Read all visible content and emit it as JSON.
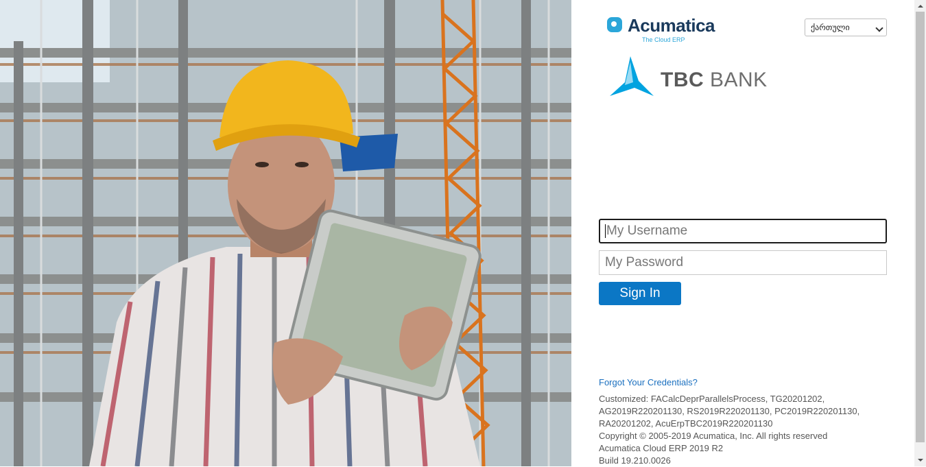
{
  "branding": {
    "acumatica_name": "Acumatica",
    "acumatica_tagline": "The Cloud ERP",
    "bank_name_bold": "TBC",
    "bank_name_rest": " BANK"
  },
  "language": {
    "selected": "ქართული"
  },
  "login": {
    "username_placeholder": "My Username",
    "password_placeholder": "My Password",
    "signin_label": "Sign In"
  },
  "footer": {
    "forgot_link": "Forgot Your Credentials?",
    "customized_line1": "Customized: FACalcDeprParallelsProcess, TG20201202,",
    "customized_line2": "AG2019R220201130, RS2019R220201130, PC2019R220201130,",
    "customized_line3": "RA20201202, AcuErpTBC2019R220201130",
    "copyright": "Copyright © 2005-2019 Acumatica, Inc. All rights reserved",
    "product": "Acumatica Cloud ERP 2019 R2",
    "build": "Build 19.210.0026"
  },
  "colors": {
    "accent": "#0b77c5",
    "link": "#1a6fbf",
    "tbc_blue": "#00a3e0",
    "helmet": "#f2b61d"
  }
}
